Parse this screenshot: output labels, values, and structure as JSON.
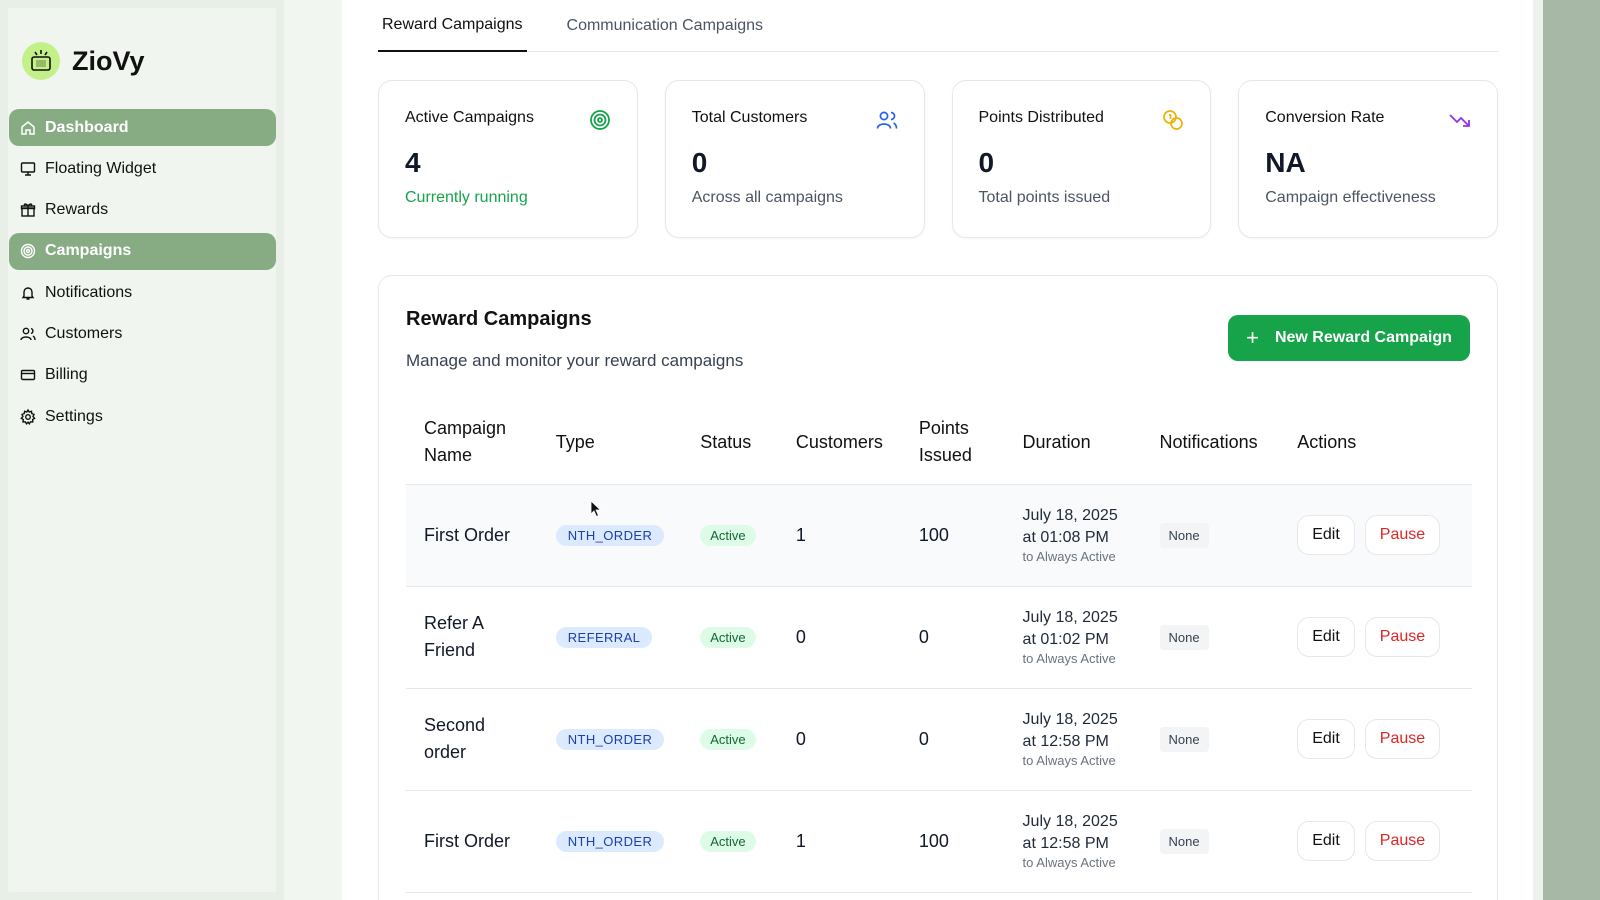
{
  "brand": {
    "name": "ZioVy"
  },
  "sidebar": {
    "items": [
      {
        "label": "Dashboard",
        "icon": "home-icon",
        "active": true
      },
      {
        "label": "Floating Widget",
        "icon": "monitor-icon",
        "active": false
      },
      {
        "label": "Rewards",
        "icon": "gift-icon",
        "active": false
      },
      {
        "label": "Campaigns",
        "icon": "target-icon",
        "active": true
      },
      {
        "label": "Notifications",
        "icon": "bell-icon",
        "active": false
      },
      {
        "label": "Customers",
        "icon": "users-icon",
        "active": false
      },
      {
        "label": "Billing",
        "icon": "credit-card-icon",
        "active": false
      },
      {
        "label": "Settings",
        "icon": "gear-icon",
        "active": false
      }
    ]
  },
  "tabs": [
    {
      "label": "Reward Campaigns",
      "active": true
    },
    {
      "label": "Communication Campaigns",
      "active": false
    }
  ],
  "stats": [
    {
      "label": "Active Campaigns",
      "value": "4",
      "sub": "Currently running",
      "icon": "target-icon",
      "color": "#16a34a"
    },
    {
      "label": "Total Customers",
      "value": "0",
      "sub": "Across all campaigns",
      "icon": "users-icon",
      "color": "#2563eb"
    },
    {
      "label": "Points Distributed",
      "value": "0",
      "sub": "Total points issued",
      "icon": "coins-icon",
      "color": "#eab308"
    },
    {
      "label": "Conversion Rate",
      "value": "NA",
      "sub": "Campaign effectiveness",
      "icon": "trending-down-icon",
      "color": "#9333ea"
    }
  ],
  "campaigns": {
    "title": "Reward Campaigns",
    "description": "Manage and monitor your reward campaigns",
    "new_button": "New Reward Campaign",
    "columns": {
      "name_1": "Campaign",
      "name_2": "Name",
      "type": "Type",
      "status": "Status",
      "customers": "Customers",
      "points_1": "Points",
      "points_2": "Issued",
      "duration": "Duration",
      "notifications": "Notifications",
      "actions": "Actions"
    },
    "rows": [
      {
        "name_1": "First Order",
        "name_2": "",
        "type": "NTH_ORDER",
        "status": "Active",
        "customers": "1",
        "points": "100",
        "date": "July 18, 2025",
        "time": "at 01:08 PM",
        "until": "to Always Active",
        "notifications": "None",
        "edit": "Edit",
        "pause": "Pause"
      },
      {
        "name_1": "Refer A",
        "name_2": "Friend",
        "type": "REFERRAL",
        "status": "Active",
        "customers": "0",
        "points": "0",
        "date": "July 18, 2025",
        "time": "at 01:02 PM",
        "until": "to Always Active",
        "notifications": "None",
        "edit": "Edit",
        "pause": "Pause"
      },
      {
        "name_1": "Second",
        "name_2": "order",
        "type": "NTH_ORDER",
        "status": "Active",
        "customers": "0",
        "points": "0",
        "date": "July 18, 2025",
        "time": "at 12:58 PM",
        "until": "to Always Active",
        "notifications": "None",
        "edit": "Edit",
        "pause": "Pause"
      },
      {
        "name_1": "First Order",
        "name_2": "",
        "type": "NTH_ORDER",
        "status": "Active",
        "customers": "1",
        "points": "100",
        "date": "July 18, 2025",
        "time": "at 12:58 PM",
        "until": "to Always Active",
        "notifications": "None",
        "edit": "Edit",
        "pause": "Pause"
      }
    ]
  }
}
